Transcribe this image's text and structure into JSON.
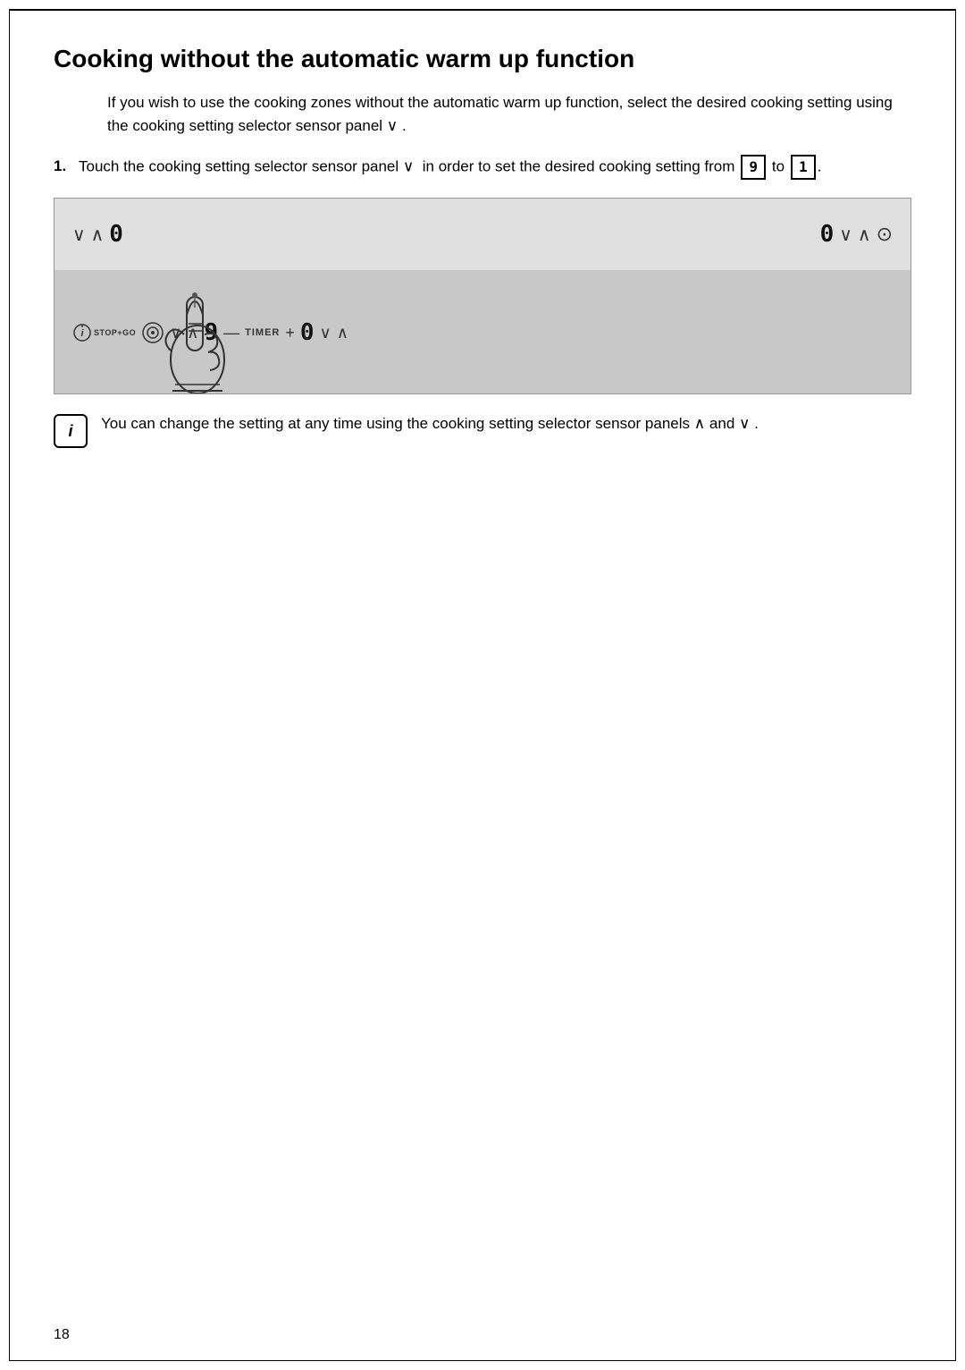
{
  "page": {
    "number": "18",
    "border_color": "#000000"
  },
  "title": "Cooking without the automatic warm up function",
  "intro": "If you wish to use the cooking zones without the automatic warm up function, select the desired cooking setting using the cooking setting selector sensor panel ∨ .",
  "steps": [
    {
      "number": "1.",
      "text_before": "Touch the cooking setting selector sensor panel ∨  in order to set the desired cooking setting from",
      "from_value": "9",
      "to_value": "1",
      "text_between": "to"
    }
  ],
  "info_text": "You can change the setting at any time using the cooking setting selector sensor panels ∧ and ∨ .",
  "panel": {
    "top_row": [
      "∨",
      "∧",
      "0",
      "0",
      "∨",
      "∧",
      "⊙"
    ],
    "bottom_row_left": [
      "power",
      "STOP+GO",
      "coil",
      "∨",
      "∧",
      "9",
      "—",
      "TIMER",
      "+",
      "0",
      "∨",
      "∧"
    ]
  }
}
